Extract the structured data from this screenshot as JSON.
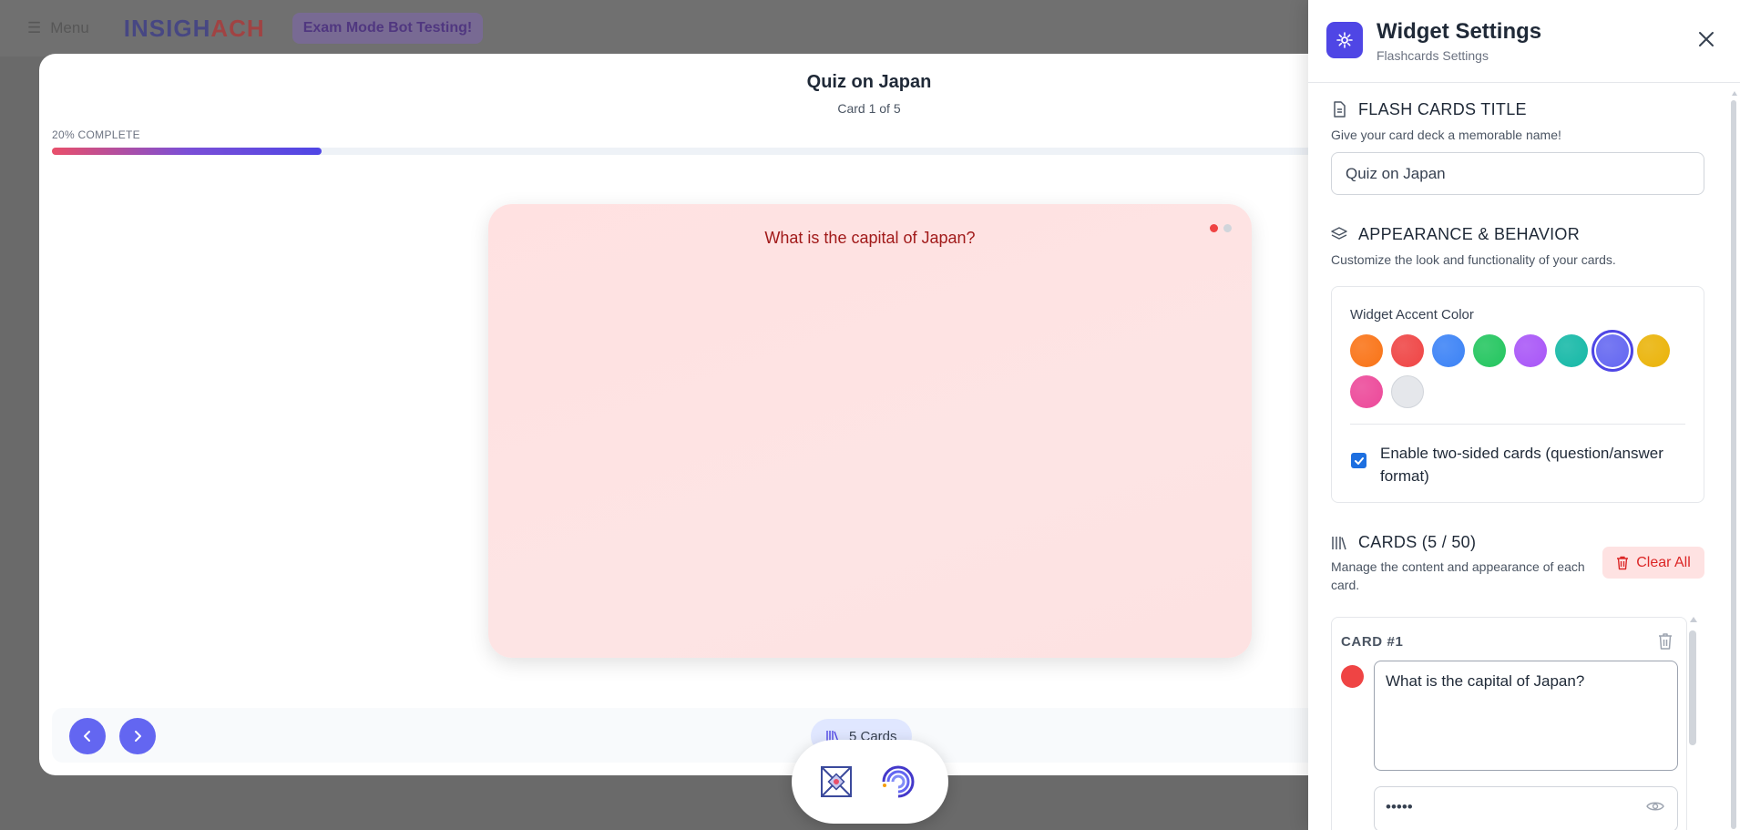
{
  "topbar": {
    "menu_label": "Menu",
    "logo_a": "INSIGH",
    "logo_b": "ACH",
    "promo": "Exam Mode Bot Testing!"
  },
  "quiz": {
    "title": "Quiz on Japan",
    "subtitle": "Card 1 of 5",
    "progress_label": "20% COMPLETE",
    "progress_fraction": 0.2
  },
  "card": {
    "question": "What is the capital of Japan?",
    "dot_colors": [
      "#ef4444",
      "#d1d5db"
    ]
  },
  "footer": {
    "cards_pill": "5 Cards"
  },
  "panel": {
    "title": "Widget Settings",
    "subtitle": "Flashcards Settings",
    "title_section": {
      "heading": "FLASH CARDS TITLE",
      "description": "Give your card deck a memorable name!",
      "value": "Quiz on Japan"
    },
    "appearance": {
      "heading": "APPEARANCE & BEHAVIOR",
      "description": "Customize the look and functionality of your cards.",
      "accent_label": "Widget Accent Color",
      "swatches": [
        "#f97316",
        "#ef4444",
        "#3b82f6",
        "#22c55e",
        "#a855f7",
        "#14b8a6",
        "#6366f1",
        "#eab308",
        "#ec4899",
        "#e5e7eb"
      ],
      "selected_swatch": "#6366f1",
      "two_sided_label": "Enable two-sided cards (question/answer format)",
      "two_sided_checked": true
    },
    "cards_section": {
      "heading": "CARDS (5 / 50)",
      "description": "Manage the content and appearance of each card.",
      "clear_all": "Clear All",
      "card1": {
        "label": "CARD #1",
        "question": "What is the capital of Japan?",
        "answer_masked": "•••••",
        "color": "#ef4444"
      }
    }
  },
  "colors": {
    "accent": "#6366f1",
    "danger": "#dc2626",
    "card_bg": "#fde2e2"
  }
}
